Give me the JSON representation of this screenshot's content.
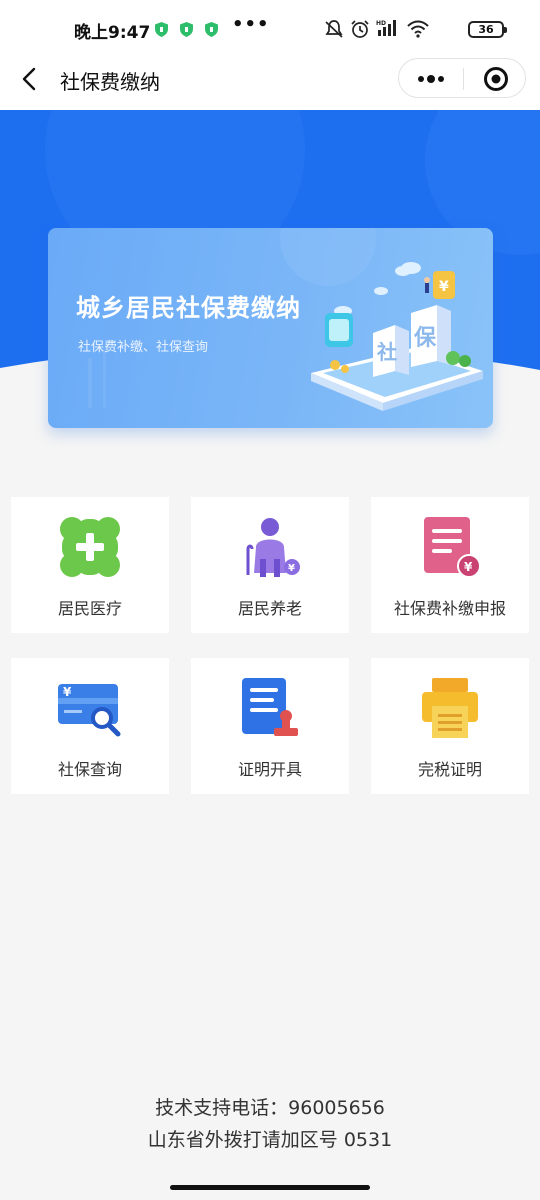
{
  "status_bar": {
    "time": "晚上9:47",
    "dots": "•••",
    "battery": "36"
  },
  "nav": {
    "title": "社保费缴纳",
    "more_icon": "more-dots-icon",
    "close_icon": "target-close-icon"
  },
  "banner": {
    "title": "城乡居民社保费缴纳",
    "subtitle": "社保费补缴、社保查询"
  },
  "services": [
    {
      "label": "居民医疗",
      "icon": "medical-cross-icon",
      "color": "#66c34a"
    },
    {
      "label": "居民养老",
      "icon": "elderly-icon",
      "color": "#8a6de0"
    },
    {
      "label": "社保费补缴申报",
      "icon": "document-yuan-icon",
      "color": "#e0628a"
    },
    {
      "label": "社保查询",
      "icon": "card-search-icon",
      "color": "#3a7fe8"
    },
    {
      "label": "证明开具",
      "icon": "certificate-stamp-icon",
      "color": "#2f72e6"
    },
    {
      "label": "完税证明",
      "icon": "printer-icon",
      "color": "#f5bd2e"
    }
  ],
  "footer": {
    "line1": "技术支持电话：96005656",
    "line2": "山东省外拨打请加区号 0531"
  },
  "colors": {
    "hero_blue": "#1e6ff0",
    "page_bg": "#f5f5f5"
  }
}
